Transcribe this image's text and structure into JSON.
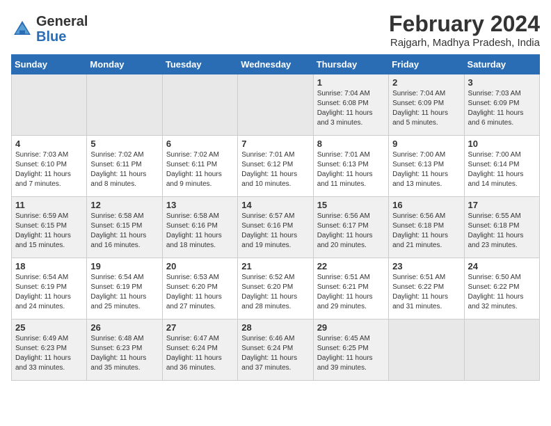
{
  "header": {
    "logo_general": "General",
    "logo_blue": "Blue",
    "month_year": "February 2024",
    "location": "Rajgarh, Madhya Pradesh, India"
  },
  "weekdays": [
    "Sunday",
    "Monday",
    "Tuesday",
    "Wednesday",
    "Thursday",
    "Friday",
    "Saturday"
  ],
  "weeks": [
    [
      {
        "day": "",
        "empty": true
      },
      {
        "day": "",
        "empty": true
      },
      {
        "day": "",
        "empty": true
      },
      {
        "day": "",
        "empty": true
      },
      {
        "day": "1",
        "sunrise": "7:04 AM",
        "sunset": "6:08 PM",
        "daylight": "11 hours and 3 minutes."
      },
      {
        "day": "2",
        "sunrise": "7:04 AM",
        "sunset": "6:09 PM",
        "daylight": "11 hours and 5 minutes."
      },
      {
        "day": "3",
        "sunrise": "7:03 AM",
        "sunset": "6:09 PM",
        "daylight": "11 hours and 6 minutes."
      }
    ],
    [
      {
        "day": "4",
        "sunrise": "7:03 AM",
        "sunset": "6:10 PM",
        "daylight": "11 hours and 7 minutes."
      },
      {
        "day": "5",
        "sunrise": "7:02 AM",
        "sunset": "6:11 PM",
        "daylight": "11 hours and 8 minutes."
      },
      {
        "day": "6",
        "sunrise": "7:02 AM",
        "sunset": "6:11 PM",
        "daylight": "11 hours and 9 minutes."
      },
      {
        "day": "7",
        "sunrise": "7:01 AM",
        "sunset": "6:12 PM",
        "daylight": "11 hours and 10 minutes."
      },
      {
        "day": "8",
        "sunrise": "7:01 AM",
        "sunset": "6:13 PM",
        "daylight": "11 hours and 11 minutes."
      },
      {
        "day": "9",
        "sunrise": "7:00 AM",
        "sunset": "6:13 PM",
        "daylight": "11 hours and 13 minutes."
      },
      {
        "day": "10",
        "sunrise": "7:00 AM",
        "sunset": "6:14 PM",
        "daylight": "11 hours and 14 minutes."
      }
    ],
    [
      {
        "day": "11",
        "sunrise": "6:59 AM",
        "sunset": "6:15 PM",
        "daylight": "11 hours and 15 minutes."
      },
      {
        "day": "12",
        "sunrise": "6:58 AM",
        "sunset": "6:15 PM",
        "daylight": "11 hours and 16 minutes."
      },
      {
        "day": "13",
        "sunrise": "6:58 AM",
        "sunset": "6:16 PM",
        "daylight": "11 hours and 18 minutes."
      },
      {
        "day": "14",
        "sunrise": "6:57 AM",
        "sunset": "6:16 PM",
        "daylight": "11 hours and 19 minutes."
      },
      {
        "day": "15",
        "sunrise": "6:56 AM",
        "sunset": "6:17 PM",
        "daylight": "11 hours and 20 minutes."
      },
      {
        "day": "16",
        "sunrise": "6:56 AM",
        "sunset": "6:18 PM",
        "daylight": "11 hours and 21 minutes."
      },
      {
        "day": "17",
        "sunrise": "6:55 AM",
        "sunset": "6:18 PM",
        "daylight": "11 hours and 23 minutes."
      }
    ],
    [
      {
        "day": "18",
        "sunrise": "6:54 AM",
        "sunset": "6:19 PM",
        "daylight": "11 hours and 24 minutes."
      },
      {
        "day": "19",
        "sunrise": "6:54 AM",
        "sunset": "6:19 PM",
        "daylight": "11 hours and 25 minutes."
      },
      {
        "day": "20",
        "sunrise": "6:53 AM",
        "sunset": "6:20 PM",
        "daylight": "11 hours and 27 minutes."
      },
      {
        "day": "21",
        "sunrise": "6:52 AM",
        "sunset": "6:20 PM",
        "daylight": "11 hours and 28 minutes."
      },
      {
        "day": "22",
        "sunrise": "6:51 AM",
        "sunset": "6:21 PM",
        "daylight": "11 hours and 29 minutes."
      },
      {
        "day": "23",
        "sunrise": "6:51 AM",
        "sunset": "6:22 PM",
        "daylight": "11 hours and 31 minutes."
      },
      {
        "day": "24",
        "sunrise": "6:50 AM",
        "sunset": "6:22 PM",
        "daylight": "11 hours and 32 minutes."
      }
    ],
    [
      {
        "day": "25",
        "sunrise": "6:49 AM",
        "sunset": "6:23 PM",
        "daylight": "11 hours and 33 minutes."
      },
      {
        "day": "26",
        "sunrise": "6:48 AM",
        "sunset": "6:23 PM",
        "daylight": "11 hours and 35 minutes."
      },
      {
        "day": "27",
        "sunrise": "6:47 AM",
        "sunset": "6:24 PM",
        "daylight": "11 hours and 36 minutes."
      },
      {
        "day": "28",
        "sunrise": "6:46 AM",
        "sunset": "6:24 PM",
        "daylight": "11 hours and 37 minutes."
      },
      {
        "day": "29",
        "sunrise": "6:45 AM",
        "sunset": "6:25 PM",
        "daylight": "11 hours and 39 minutes."
      },
      {
        "day": "",
        "empty": true
      },
      {
        "day": "",
        "empty": true
      }
    ]
  ]
}
